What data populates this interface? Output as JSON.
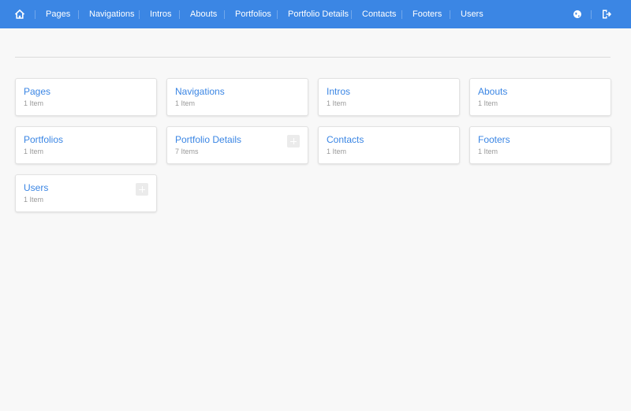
{
  "colors": {
    "topbar": "#3b86e4",
    "background": "#f8f8f8",
    "card_title": "#3b86e4",
    "card_count": "#9a9a9a"
  },
  "nav": {
    "home_icon": "home-icon",
    "items": [
      {
        "label": "Pages"
      },
      {
        "label": "Navigations"
      },
      {
        "label": "Intros"
      },
      {
        "label": "Abouts"
      },
      {
        "label": "Portfolios"
      },
      {
        "label": "Portfolio Details"
      },
      {
        "label": "Contacts"
      },
      {
        "label": "Footers"
      },
      {
        "label": "Users"
      }
    ],
    "right_icons": [
      "globe-icon",
      "logout-icon"
    ]
  },
  "cards": [
    {
      "title": "Pages",
      "count": "1 Item",
      "has_add": false
    },
    {
      "title": "Navigations",
      "count": "1 Item",
      "has_add": false
    },
    {
      "title": "Intros",
      "count": "1 Item",
      "has_add": false
    },
    {
      "title": "Abouts",
      "count": "1 Item",
      "has_add": false
    },
    {
      "title": "Portfolios",
      "count": "1 Item",
      "has_add": false
    },
    {
      "title": "Portfolio Details",
      "count": "7 Items",
      "has_add": true
    },
    {
      "title": "Contacts",
      "count": "1 Item",
      "has_add": false
    },
    {
      "title": "Footers",
      "count": "1 Item",
      "has_add": false
    },
    {
      "title": "Users",
      "count": "1 Item",
      "has_add": true
    }
  ]
}
